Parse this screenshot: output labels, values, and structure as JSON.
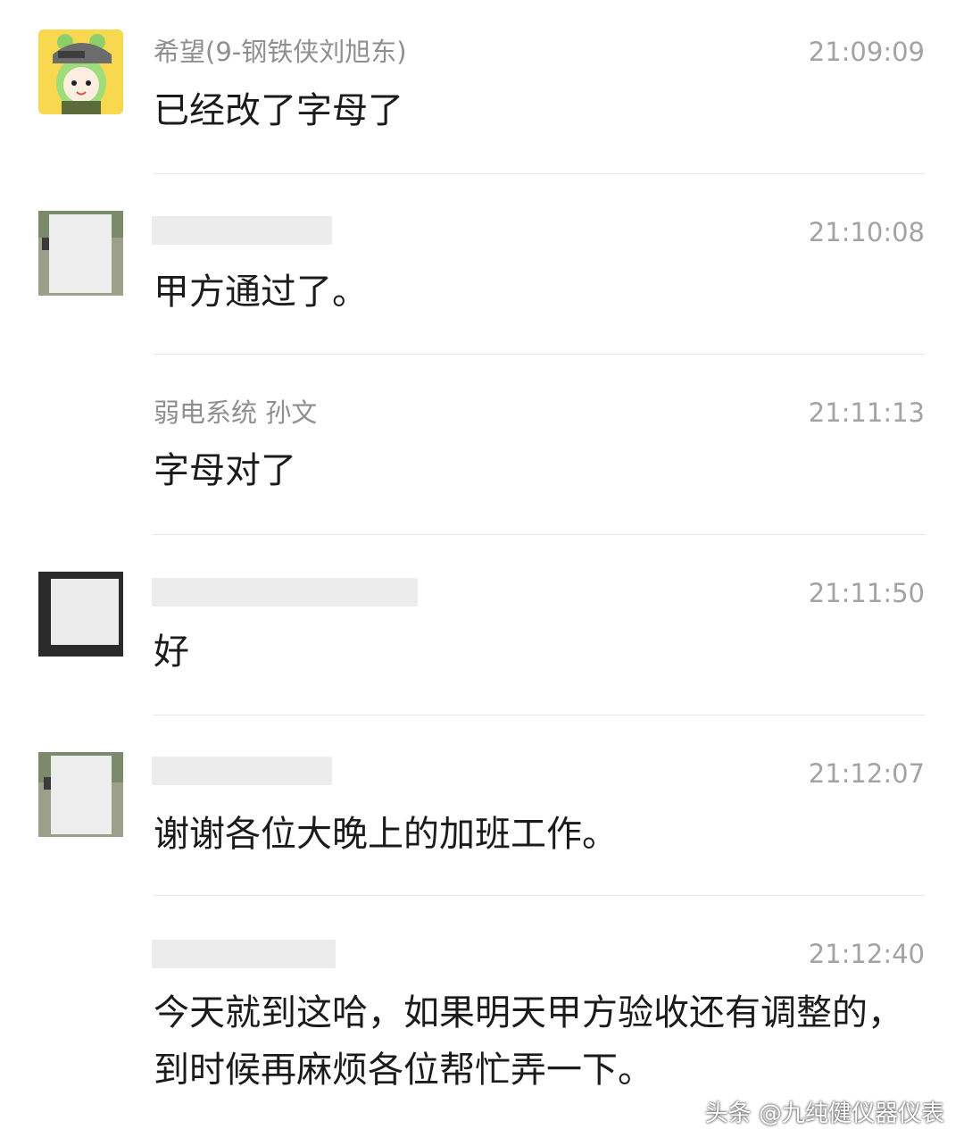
{
  "messages": [
    {
      "sender": "希望(9-钢铁侠刘旭东)",
      "time": "21:09:09",
      "text": "已经改了字母了",
      "avatar_icon": "helmet-cartoon-avatar"
    },
    {
      "sender": "",
      "time": "21:10:08",
      "text": "甲方通过了。",
      "avatar_icon": "blurred-photo-avatar"
    },
    {
      "sender": "弱电系统 孙文",
      "time": "21:11:13",
      "text": "字母对了",
      "avatar_icon": ""
    },
    {
      "sender": "",
      "time": "21:11:50",
      "text": "好",
      "avatar_icon": "blurred-dark-avatar"
    },
    {
      "sender": "",
      "time": "21:12:07",
      "text": "谢谢各位大晚上的加班工作。",
      "avatar_icon": "blurred-photo-avatar"
    },
    {
      "sender": "",
      "time": "21:12:40",
      "text": "今天就到这哈，如果明天甲方验收还有调整的，到时候再麻烦各位帮忙弄一下。",
      "avatar_icon": ""
    }
  ],
  "watermark": "头条 @九纯健仪器仪表",
  "colors": {
    "sender": "#8f8f8f",
    "time": "#a3a3a3",
    "text": "#1b1b1b",
    "divider": "#e8e8e8",
    "blur": "#ececec"
  }
}
